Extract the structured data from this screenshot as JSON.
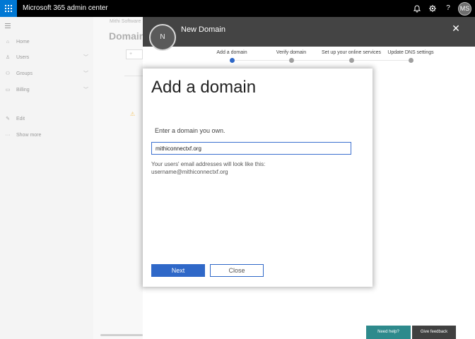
{
  "topbar": {
    "app_title": "Microsoft 365 admin center",
    "avatar_initials": "MS",
    "icons": [
      "waffle-icon",
      "bell-icon",
      "gear-icon",
      "help-icon"
    ]
  },
  "nav": {
    "items": [
      {
        "label": "Home",
        "icon": "home-icon"
      },
      {
        "label": "Users",
        "icon": "user-icon"
      },
      {
        "label": "Groups",
        "icon": "group-icon"
      },
      {
        "label": "Billing",
        "icon": "billing-icon"
      },
      {
        "label": "Edit",
        "icon": "edit-icon"
      },
      {
        "label": "Show more",
        "icon": "more-icon"
      }
    ]
  },
  "background_page": {
    "breadcrumb": "Mithi Software",
    "heading": "Domain",
    "button_label": "+"
  },
  "panel": {
    "avatar_initial": "N",
    "title": "New Domain",
    "steps": [
      {
        "label": "Add a domain",
        "active": true
      },
      {
        "label": "Verify domain",
        "active": false
      },
      {
        "label": "Set up your online services",
        "active": false
      },
      {
        "label": "Update DNS settings",
        "active": false
      }
    ]
  },
  "dialog": {
    "title": "Add a domain",
    "instruction": "Enter a domain you own.",
    "domain_value": "mithiconnectxf.org",
    "preview_label": "Your users' email addresses will look like this:",
    "preview_value": "username@mithiconnectxf.org",
    "next_label": "Next",
    "close_label": "Close"
  },
  "footer": {
    "help_label": "Need help?",
    "feedback_label": "Give feedback"
  },
  "colors": {
    "accent": "#2f68c8",
    "waffle": "#0078d4",
    "panel_header": "#444444",
    "help": "#2e8a8c"
  }
}
